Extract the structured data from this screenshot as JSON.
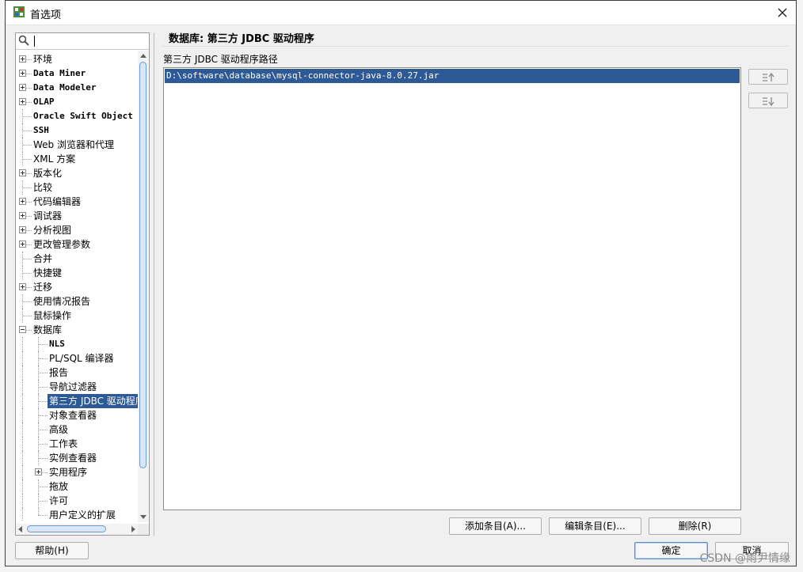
{
  "window": {
    "title": "首选项"
  },
  "search": {
    "value": "",
    "placeholder": ""
  },
  "tree": {
    "items": [
      {
        "label": "环境",
        "level": 0,
        "expander": "plus",
        "mono": false
      },
      {
        "label": "Data Miner",
        "level": 0,
        "expander": "plus",
        "mono": true
      },
      {
        "label": "Data Modeler",
        "level": 0,
        "expander": "plus",
        "mono": true
      },
      {
        "label": "OLAP",
        "level": 0,
        "expander": "plus",
        "mono": true
      },
      {
        "label": "Oracle Swift Object St",
        "level": 0,
        "expander": "none",
        "mono": true
      },
      {
        "label": "SSH",
        "level": 0,
        "expander": "none",
        "mono": true
      },
      {
        "label": "Web 浏览器和代理",
        "level": 0,
        "expander": "none",
        "mono": false
      },
      {
        "label": "XML 方案",
        "level": 0,
        "expander": "none",
        "mono": false
      },
      {
        "label": "版本化",
        "level": 0,
        "expander": "plus",
        "mono": false
      },
      {
        "label": "比较",
        "level": 0,
        "expander": "none",
        "mono": false
      },
      {
        "label": "代码编辑器",
        "level": 0,
        "expander": "plus",
        "mono": false
      },
      {
        "label": "调试器",
        "level": 0,
        "expander": "plus",
        "mono": false
      },
      {
        "label": "分析视图",
        "level": 0,
        "expander": "plus",
        "mono": false
      },
      {
        "label": "更改管理参数",
        "level": 0,
        "expander": "plus",
        "mono": false
      },
      {
        "label": "合并",
        "level": 0,
        "expander": "none",
        "mono": false
      },
      {
        "label": "快捷键",
        "level": 0,
        "expander": "none",
        "mono": false
      },
      {
        "label": "迁移",
        "level": 0,
        "expander": "plus",
        "mono": false
      },
      {
        "label": "使用情况报告",
        "level": 0,
        "expander": "none",
        "mono": false
      },
      {
        "label": "鼠标操作",
        "level": 0,
        "expander": "none",
        "mono": false
      },
      {
        "label": "数据库",
        "level": 0,
        "expander": "minus",
        "mono": false
      },
      {
        "label": "NLS",
        "level": 1,
        "expander": "none",
        "mono": true
      },
      {
        "label": "PL/SQL 编译器",
        "level": 1,
        "expander": "none",
        "mono": false
      },
      {
        "label": "报告",
        "level": 1,
        "expander": "none",
        "mono": false
      },
      {
        "label": "导航过滤器",
        "level": 1,
        "expander": "none",
        "mono": false
      },
      {
        "label": "第三方 JDBC 驱动程序",
        "level": 1,
        "expander": "none",
        "mono": false,
        "selected": true
      },
      {
        "label": "对象查看器",
        "level": 1,
        "expander": "none",
        "mono": false
      },
      {
        "label": "高级",
        "level": 1,
        "expander": "none",
        "mono": false
      },
      {
        "label": "工作表",
        "level": 1,
        "expander": "none",
        "mono": false
      },
      {
        "label": "实例查看器",
        "level": 1,
        "expander": "none",
        "mono": false
      },
      {
        "label": "实用程序",
        "level": 1,
        "expander": "plus",
        "mono": false
      },
      {
        "label": "拖放",
        "level": 1,
        "expander": "none",
        "mono": false
      },
      {
        "label": "许可",
        "level": 1,
        "expander": "none",
        "mono": false
      },
      {
        "label": "用户定义的扩展",
        "level": 1,
        "expander": "none",
        "mono": false
      }
    ]
  },
  "panel": {
    "header": "数据库: 第三方 JDBC 驱动程序",
    "path_label": "第三方 JDBC 驱动程序路径",
    "paths": [
      "D:\\software\\database\\mysql-connector-java-8.0.27.jar"
    ],
    "move_up_icon": "move-up-icon",
    "move_down_icon": "move-down-icon"
  },
  "buttons": {
    "add": "添加条目(A)...",
    "edit": "编辑条目(E)...",
    "delete": "删除(R)",
    "help": "帮助(H)",
    "ok": "确定",
    "cancel": "取消"
  },
  "watermark": "CSDN @雨尹情缘",
  "colors": {
    "selection": "#2d5a96",
    "scroll_thumb": "#d8e6f6"
  }
}
